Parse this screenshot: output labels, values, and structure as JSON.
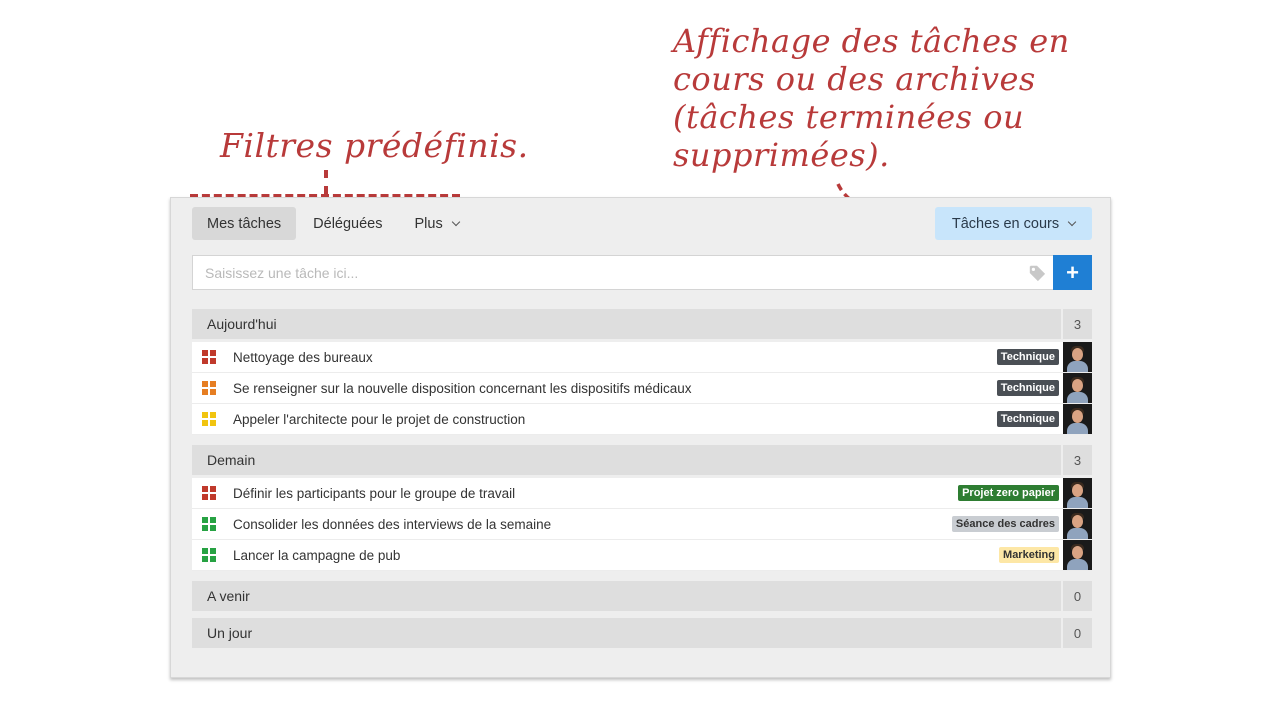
{
  "annotations": {
    "filters": "Filtres prédéfinis.",
    "archive_lines": [
      "Affichage des tâches en",
      "cours ou des archives",
      "(tâches terminées ou",
      "supprimées)."
    ]
  },
  "tabs": [
    {
      "label": "Mes tâches",
      "active": true
    },
    {
      "label": "Déléguées",
      "active": false
    },
    {
      "label": "Plus",
      "active": false,
      "dropdown": true
    }
  ],
  "status_filter": {
    "label": "Tâches en cours"
  },
  "task_input": {
    "placeholder": "Saisissez une tâche ici...",
    "add_label": "+"
  },
  "colors": {
    "annotation": "#b83a3a",
    "accent": "#1f7fd4",
    "status_bg": "#c8e5fb",
    "priority_red": "#c0392b",
    "priority_orange": "#e67e22",
    "priority_yellow": "#f1c40f",
    "priority_green": "#27a243"
  },
  "groups": [
    {
      "title": "Aujourd'hui",
      "count": "3",
      "tasks": [
        {
          "label": "Nettoyage des bureaux",
          "priority": "red",
          "tag": {
            "text": "Technique",
            "bg": "#4a4f55",
            "fg": "#ffffff"
          }
        },
        {
          "label": "Se renseigner sur la nouvelle disposition concernant les dispositifs médicaux",
          "priority": "orange",
          "tag": {
            "text": "Technique",
            "bg": "#4a4f55",
            "fg": "#ffffff"
          }
        },
        {
          "label": "Appeler l'architecte pour le projet de construction",
          "priority": "yellow",
          "tag": {
            "text": "Technique",
            "bg": "#4a4f55",
            "fg": "#ffffff"
          }
        }
      ]
    },
    {
      "title": "Demain",
      "count": "3",
      "tasks": [
        {
          "label": "Définir les participants pour le groupe de travail",
          "priority": "red",
          "tag": {
            "text": "Projet zero papier",
            "bg": "#2e7d32",
            "fg": "#ffffff"
          }
        },
        {
          "label": "Consolider les données des interviews de la semaine",
          "priority": "green",
          "tag": {
            "text": "Séance des cadres",
            "bg": "#c9cdd2",
            "fg": "#333333"
          }
        },
        {
          "label": "Lancer la campagne de pub",
          "priority": "green",
          "tag": {
            "text": "Marketing",
            "bg": "#fde7a6",
            "fg": "#333333"
          }
        }
      ]
    },
    {
      "title": "A venir",
      "count": "0",
      "tasks": []
    },
    {
      "title": "Un jour",
      "count": "0",
      "tasks": []
    }
  ]
}
